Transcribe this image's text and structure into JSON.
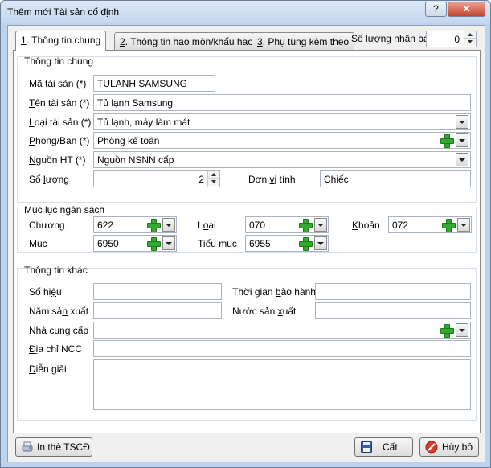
{
  "window": {
    "title": "Thêm mới Tài sản cố định",
    "help_glyph": "?",
    "close_glyph": "✕"
  },
  "tabs": [
    {
      "num": "1",
      "label": ". Thông tin chung"
    },
    {
      "num": "2",
      "label": ". Thông tin hao mòn/khấu hao"
    },
    {
      "num": "3",
      "label": ". Phụ tùng kèm theo"
    }
  ],
  "copies": {
    "label": "Số lượng nhân bản",
    "value": "0"
  },
  "general": {
    "title": "Thông tin chung",
    "asset_code": {
      "label": "Mã tài sản (*)",
      "value": "TULANH SAMSUNG"
    },
    "asset_name": {
      "label": "Tên tài sản (*)",
      "value": "Tủ lạnh Samsung"
    },
    "asset_type": {
      "label": "Loại tài sản (*)",
      "value": "Tủ lạnh, máy làm mát"
    },
    "department": {
      "label": "Phòng/Ban (*)",
      "value": "Phòng kế toán"
    },
    "source": {
      "label": "Nguồn HT (*)",
      "value": "Nguồn NSNN cấp"
    },
    "quantity": {
      "label": "Số lượng",
      "value": "2"
    },
    "unit": {
      "label": "Đơn vị tính",
      "value": "Chiếc"
    }
  },
  "budget": {
    "title": "Mục lục ngân sách",
    "chuong": {
      "label": "Chương",
      "value": "622"
    },
    "loai": {
      "label": "Loại",
      "value": "070"
    },
    "khoan": {
      "label": "Khoản",
      "value": "072"
    },
    "muc": {
      "label": "Mục",
      "value": "6950"
    },
    "tieu_muc": {
      "label": "Tiểu mục",
      "value": "6955"
    }
  },
  "other": {
    "title": "Thông tin khác",
    "serial": {
      "label": "Số hiệu",
      "value": ""
    },
    "warranty": {
      "label": "Thời gian bảo hành",
      "value": ""
    },
    "year": {
      "label": "Năm sản xuất",
      "value": ""
    },
    "country": {
      "label": "Nước sản xuất",
      "value": ""
    },
    "supplier": {
      "label": "Nhà cung cấp",
      "value": ""
    },
    "supplier_address": {
      "label": "Địa chỉ NCC",
      "value": ""
    },
    "notes": {
      "label": "Diễn giải",
      "value": ""
    }
  },
  "buttons": {
    "print": "In thẻ TSCĐ",
    "save": "Cất",
    "cancel": "Hủy bỏ"
  },
  "icons": {
    "print": "card-print-icon",
    "save": "floppy-disk-icon",
    "cancel": "no-entry-icon",
    "add": "green-plus-icon"
  }
}
